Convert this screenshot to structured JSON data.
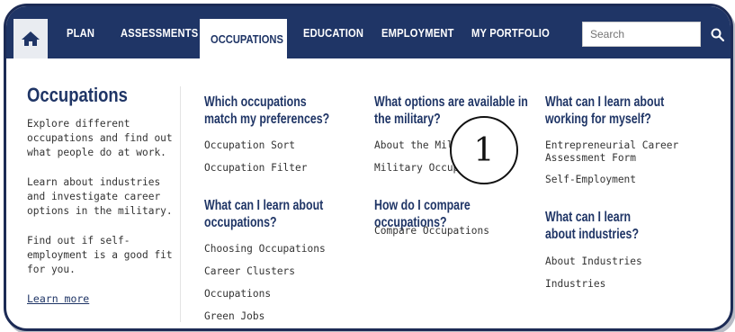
{
  "nav": {
    "items": [
      "PLAN",
      "ASSESSMENTS",
      "OCCUPATIONS",
      "EDUCATION",
      "EMPLOYMENT",
      "MY PORTFOLIO"
    ],
    "active_index": 2,
    "search_placeholder": "Search",
    "colors": {
      "nav_bg": "#1f3566",
      "active_bg": "#ffffff"
    }
  },
  "intro": {
    "title": "Occupations",
    "paragraphs": [
      "Explore different occupations and find out what people do at work.",
      "Learn about industries and investigate career options in the military.",
      "Find out if self-employment is a good fit for you."
    ],
    "learn_more": "Learn more"
  },
  "columns": [
    {
      "sections": [
        {
          "heading": "Which occupations match my preferences?",
          "links": [
            "Occupation Sort",
            "Occupation Filter"
          ]
        },
        {
          "heading": "What can I learn about occupations?",
          "links": [
            "Choosing Occupations",
            "Career Clusters",
            "Occupations",
            "Green Jobs"
          ]
        }
      ]
    },
    {
      "sections": [
        {
          "heading": "What options are available in the military?",
          "links": [
            "About the Military",
            "Military Occupations"
          ]
        },
        {
          "heading": "How do I compare occupations?",
          "links": [
            "Compare Occupations"
          ]
        }
      ]
    },
    {
      "sections": [
        {
          "heading": "What can I learn about working for myself?",
          "links": [
            "Entrepreneurial Career Assessment Form",
            "Self-Employment"
          ]
        },
        {
          "heading": "What can I learn about industries?",
          "links": [
            "About Industries",
            "Industries"
          ]
        }
      ]
    }
  ],
  "callout": "1"
}
